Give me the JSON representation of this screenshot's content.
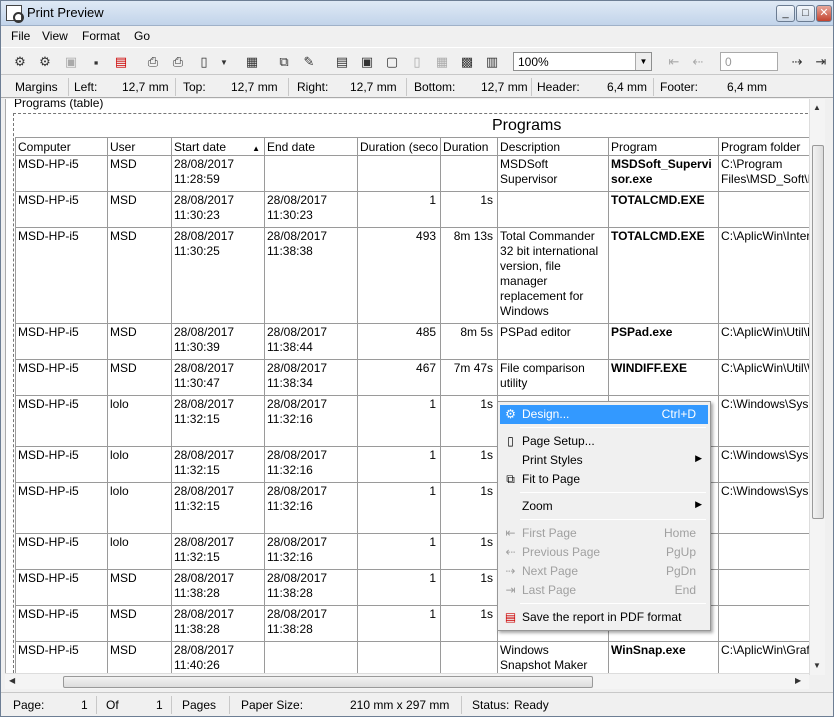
{
  "window": {
    "title": "Print Preview"
  },
  "menu": [
    "File",
    "View",
    "Format",
    "Go"
  ],
  "toolbar": {
    "zoom": "100%",
    "page": "0",
    "icons": [
      "design-icon",
      "page-setup-icon",
      "open-icon",
      "save-icon",
      "pdf-icon",
      "print-icon",
      "quick-print-icon",
      "book-icon",
      "grid-icon",
      "fit-icon",
      "copy-icon",
      "one-page-icon",
      "two-pages-icon",
      "four-pages-icon",
      "multi-page-icon",
      "first-page-icon",
      "prev-page-icon",
      "next-page-icon",
      "last-page-icon"
    ]
  },
  "margins": {
    "label": "Margins",
    "left_label": "Left:",
    "left": "12,7 mm",
    "top_label": "Top:",
    "top": "12,7 mm",
    "right_label": "Right:",
    "right": "12,7 mm",
    "bottom_label": "Bottom:",
    "bottom": "12,7 mm",
    "header_label": "Header:",
    "header": "6,4 mm",
    "footer_label": "Footer:",
    "footer": "6,4 mm"
  },
  "report": {
    "caption": "Programs (table)",
    "title": "Programs",
    "columns": [
      "Computer",
      "User",
      "Start date",
      "End date",
      "Duration (seco",
      "Duration",
      "Description",
      "Program",
      "Program folder"
    ],
    "rows": [
      [
        "MSD-HP-i5",
        "MSD",
        "28/08/2017\n11:28:59",
        "",
        "",
        "",
        "MSDSoft\nSupervisor",
        "MSDSoft_Supervi\nsor.exe",
        "C:\\Program\nFiles\\MSD_Soft\\M"
      ],
      [
        "MSD-HP-i5",
        "MSD",
        "28/08/2017\n11:30:23",
        "28/08/2017\n11:30:23",
        "1",
        "1s",
        "",
        "TOTALCMD.EXE",
        ""
      ],
      [
        "MSD-HP-i5",
        "MSD",
        "28/08/2017\n11:30:25",
        "28/08/2017\n11:38:38",
        "493",
        "8m 13s",
        "Total Commander\n32 bit international\nversion, file\nmanager\nreplacement for\nWindows",
        "TOTALCMD.EXE",
        "C:\\AplicWin\\Inter"
      ],
      [
        "MSD-HP-i5",
        "MSD",
        "28/08/2017\n11:30:39",
        "28/08/2017\n11:38:44",
        "485",
        "8m 5s",
        "PSPad editor",
        "PSPad.exe",
        "C:\\AplicWin\\Util\\F"
      ],
      [
        "MSD-HP-i5",
        "MSD",
        "28/08/2017\n11:30:47",
        "28/08/2017\n11:38:34",
        "467",
        "7m 47s",
        "File comparison\nutility",
        "WINDIFF.EXE",
        "C:\\AplicWin\\Util\\W"
      ],
      [
        "MSD-HP-i5",
        "lolo",
        "28/08/2017\n11:32:15",
        "28/08/2017\n11:32:16",
        "1",
        "1s",
        "",
        "",
        "C:\\Windows\\Sys"
      ],
      [
        "MSD-HP-i5",
        "lolo",
        "28/08/2017\n11:32:15",
        "28/08/2017\n11:32:16",
        "1",
        "1s",
        "",
        "",
        "C:\\Windows\\Sys"
      ],
      [
        "MSD-HP-i5",
        "lolo",
        "28/08/2017\n11:32:15",
        "28/08/2017\n11:32:16",
        "1",
        "1s",
        "",
        "",
        "C:\\Windows\\Sys"
      ],
      [
        "MSD-HP-i5",
        "lolo",
        "28/08/2017\n11:32:15",
        "28/08/2017\n11:32:16",
        "1",
        "1s",
        "",
        "",
        ""
      ],
      [
        "MSD-HP-i5",
        "MSD",
        "28/08/2017\n11:38:28",
        "28/08/2017\n11:38:28",
        "1",
        "1s",
        "",
        "",
        ""
      ],
      [
        "MSD-HP-i5",
        "MSD",
        "28/08/2017\n11:38:28",
        "28/08/2017\n11:38:28",
        "1",
        "1s",
        "",
        "",
        ""
      ],
      [
        "MSD-HP-i5",
        "MSD",
        "28/08/2017\n11:40:26",
        "",
        "",
        "",
        "Windows\nSnapshot Maker",
        "WinSnap.exe",
        "C:\\AplicWin\\Graf"
      ]
    ]
  },
  "context_menu": {
    "design": "Design...",
    "design_key": "Ctrl+D",
    "page_setup": "Page Setup...",
    "print_styles": "Print Styles",
    "fit_to_page": "Fit to Page",
    "zoom": "Zoom",
    "first_page": "First Page",
    "first_page_key": "Home",
    "previous_page": "Previous Page",
    "previous_page_key": "PgUp",
    "next_page": "Next Page",
    "next_page_key": "PgDn",
    "last_page": "Last Page",
    "last_page_key": "End",
    "save_pdf": "Save the report in PDF format"
  },
  "status": {
    "page_label": "Page:",
    "page": "1",
    "of_label": "Of",
    "of": "1",
    "pages_label": "Pages",
    "paper_label": "Paper Size:",
    "paper": "210 mm x 297 mm",
    "status_label": "Status:",
    "status": "Ready"
  }
}
